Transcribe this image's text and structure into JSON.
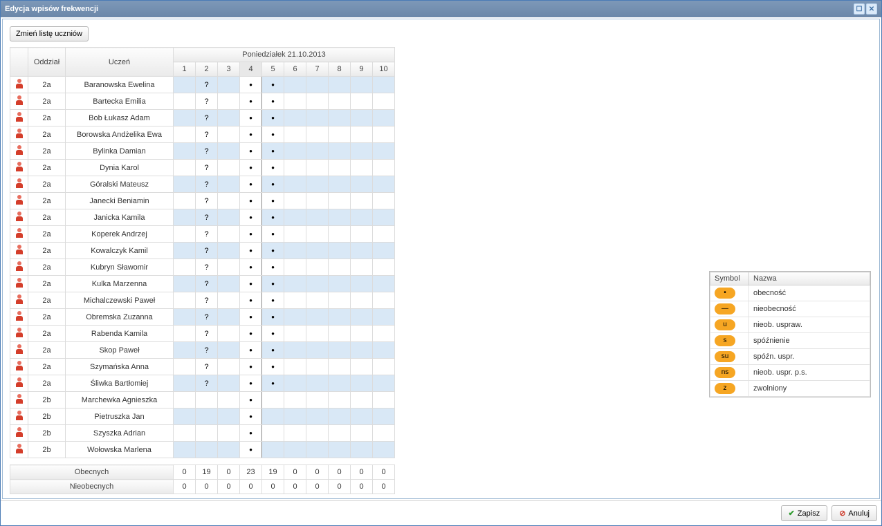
{
  "window": {
    "title": "Edycja wpisów frekwencji"
  },
  "toolbar": {
    "change_students_label": "Zmień listę uczniów"
  },
  "headers": {
    "class": "Oddział",
    "student": "Uczeń",
    "day": "Poniedziałek 21.10.2013",
    "periods": [
      "1",
      "2",
      "3",
      "4",
      "5",
      "6",
      "7",
      "8",
      "9",
      "10"
    ]
  },
  "legend": {
    "col_symbol": "Symbol",
    "col_name": "Nazwa",
    "items": [
      {
        "sym": "•",
        "name": "obecność"
      },
      {
        "sym": "—",
        "name": "nieobecność"
      },
      {
        "sym": "u",
        "name": "nieob. uspraw."
      },
      {
        "sym": "s",
        "name": "spóźnienie"
      },
      {
        "sym": "su",
        "name": "spóźn. uspr."
      },
      {
        "sym": "ns",
        "name": "nieob. uspr. p.s."
      },
      {
        "sym": "z",
        "name": "zwolniony"
      }
    ]
  },
  "summary": {
    "present_label": "Obecnych",
    "absent_label": "Nieobecnych",
    "present": [
      0,
      19,
      0,
      23,
      19,
      0,
      0,
      0,
      0,
      0
    ],
    "absent": [
      0,
      0,
      0,
      0,
      0,
      0,
      0,
      0,
      0,
      0
    ]
  },
  "footer": {
    "save_label": "Zapisz",
    "cancel_label": "Anuluj"
  },
  "rows": [
    {
      "class": "2a",
      "name": "Baranowska Ewelina",
      "marks": [
        "",
        "?",
        "",
        "•",
        "•",
        "",
        "",
        "",
        "",
        ""
      ]
    },
    {
      "class": "2a",
      "name": "Bartecka Emilia",
      "marks": [
        "",
        "?",
        "",
        "•",
        "•",
        "",
        "",
        "",
        "",
        ""
      ]
    },
    {
      "class": "2a",
      "name": "Bob Łukasz Adam",
      "marks": [
        "",
        "?",
        "",
        "•",
        "•",
        "",
        "",
        "",
        "",
        ""
      ]
    },
    {
      "class": "2a",
      "name": "Borowska Andżelika Ewa",
      "marks": [
        "",
        "?",
        "",
        "•",
        "•",
        "",
        "",
        "",
        "",
        ""
      ]
    },
    {
      "class": "2a",
      "name": "Bylinka Damian",
      "marks": [
        "",
        "?",
        "",
        "•",
        "•",
        "",
        "",
        "",
        "",
        ""
      ]
    },
    {
      "class": "2a",
      "name": "Dynia Karol",
      "marks": [
        "",
        "?",
        "",
        "•",
        "•",
        "",
        "",
        "",
        "",
        ""
      ]
    },
    {
      "class": "2a",
      "name": "Góralski Mateusz",
      "marks": [
        "",
        "?",
        "",
        "•",
        "•",
        "",
        "",
        "",
        "",
        ""
      ]
    },
    {
      "class": "2a",
      "name": "Janecki Beniamin",
      "marks": [
        "",
        "?",
        "",
        "•",
        "•",
        "",
        "",
        "",
        "",
        ""
      ]
    },
    {
      "class": "2a",
      "name": "Janicka Kamila",
      "marks": [
        "",
        "?",
        "",
        "•",
        "•",
        "",
        "",
        "",
        "",
        ""
      ]
    },
    {
      "class": "2a",
      "name": "Koperek Andrzej",
      "marks": [
        "",
        "?",
        "",
        "•",
        "•",
        "",
        "",
        "",
        "",
        ""
      ]
    },
    {
      "class": "2a",
      "name": "Kowalczyk Kamil",
      "marks": [
        "",
        "?",
        "",
        "•",
        "•",
        "",
        "",
        "",
        "",
        ""
      ]
    },
    {
      "class": "2a",
      "name": "Kubryn Sławomir",
      "marks": [
        "",
        "?",
        "",
        "•",
        "•",
        "",
        "",
        "",
        "",
        ""
      ]
    },
    {
      "class": "2a",
      "name": "Kulka Marzenna",
      "marks": [
        "",
        "?",
        "",
        "•",
        "•",
        "",
        "",
        "",
        "",
        ""
      ]
    },
    {
      "class": "2a",
      "name": "Michalczewski Paweł",
      "marks": [
        "",
        "?",
        "",
        "•",
        "•",
        "",
        "",
        "",
        "",
        ""
      ]
    },
    {
      "class": "2a",
      "name": "Obremska Zuzanna",
      "marks": [
        "",
        "?",
        "",
        "•",
        "•",
        "",
        "",
        "",
        "",
        ""
      ]
    },
    {
      "class": "2a",
      "name": "Rabenda Kamila",
      "marks": [
        "",
        "?",
        "",
        "•",
        "•",
        "",
        "",
        "",
        "",
        ""
      ]
    },
    {
      "class": "2a",
      "name": "Skop Paweł",
      "marks": [
        "",
        "?",
        "",
        "•",
        "•",
        "",
        "",
        "",
        "",
        ""
      ]
    },
    {
      "class": "2a",
      "name": "Szymańska Anna",
      "marks": [
        "",
        "?",
        "",
        "•",
        "•",
        "",
        "",
        "",
        "",
        ""
      ]
    },
    {
      "class": "2a",
      "name": "Śliwka Bartłomiej",
      "marks": [
        "",
        "?",
        "",
        "•",
        "•",
        "",
        "",
        "",
        "",
        ""
      ]
    },
    {
      "class": "2b",
      "name": "Marchewka Agnieszka",
      "marks": [
        "",
        "",
        "",
        "•",
        "",
        "",
        "",
        "",
        "",
        ""
      ]
    },
    {
      "class": "2b",
      "name": "Pietruszka Jan",
      "marks": [
        "",
        "",
        "",
        "•",
        "",
        "",
        "",
        "",
        "",
        ""
      ]
    },
    {
      "class": "2b",
      "name": "Szyszka Adrian",
      "marks": [
        "",
        "",
        "",
        "•",
        "",
        "",
        "",
        "",
        "",
        ""
      ]
    },
    {
      "class": "2b",
      "name": "Wołowska Marlena",
      "marks": [
        "",
        "",
        "",
        "•",
        "",
        "",
        "",
        "",
        "",
        ""
      ]
    }
  ],
  "selected_column_index": 3
}
